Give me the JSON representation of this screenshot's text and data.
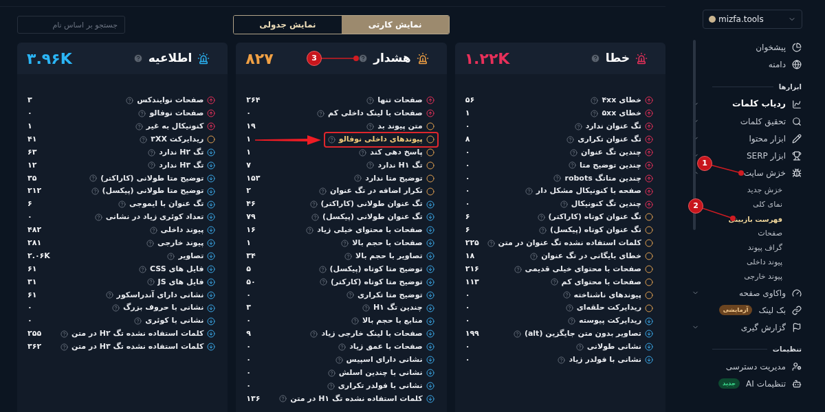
{
  "sidebar": {
    "domain": "mizfa.tools",
    "sections": [
      {
        "items": [
          {
            "label": "پیشخوان",
            "active": false
          },
          {
            "label": "دامنه",
            "active": false
          }
        ]
      },
      {
        "title": "ابزارها",
        "items": [
          {
            "label": "ردیاب کلمات",
            "active": true,
            "expanded": false
          },
          {
            "label": "تحقیق کلمات",
            "active": false,
            "expanded": false
          },
          {
            "label": "ابزار محتوا",
            "active": false,
            "expanded": false
          },
          {
            "label": "ابزار SERP",
            "active": false,
            "expanded": false
          },
          {
            "label": "خزش سایت",
            "active": false,
            "expanded": true,
            "children": [
              {
                "label": "خزش جدید",
                "selected": false
              },
              {
                "label": "نمای کلی",
                "selected": false
              },
              {
                "label": "فهرست بازبینی",
                "selected": true
              },
              {
                "label": "صفحات",
                "selected": false
              },
              {
                "label": "گراف پیوند",
                "selected": false
              },
              {
                "label": "پیوند داخلی",
                "selected": false
              },
              {
                "label": "پیوند خارجی",
                "selected": false
              }
            ]
          },
          {
            "label": "واکاوی صفحه",
            "active": false,
            "expanded": false
          },
          {
            "label": "بک لینک",
            "active": false,
            "badge": {
              "text": "آزمایشی",
              "kind": "beta"
            }
          },
          {
            "label": "گزارش گیری",
            "active": false,
            "expanded": false
          }
        ]
      },
      {
        "title": "تنظیمات",
        "items": [
          {
            "label": "مدیریت دسترسی",
            "active": false
          },
          {
            "label": "تنظیمات AI",
            "active": false,
            "badge": {
              "text": "جدید",
              "kind": "new"
            }
          }
        ]
      }
    ]
  },
  "view_tabs": [
    {
      "label": "نمایش کارتی",
      "selected": true
    },
    {
      "label": "نمایش جدولی",
      "selected": false
    }
  ],
  "search": {
    "placeholder": "جستجو بر اساس نام"
  },
  "cards": [
    {
      "title": "خطا",
      "total": "۱.۲۲K",
      "color": "#e8305a",
      "rows": [
        {
          "label": "خطای ۴xx",
          "value": "۵۶",
          "kind": "up",
          "highlighted": false
        },
        {
          "label": "خطای ۵xx",
          "value": "۱",
          "kind": "up",
          "highlighted": false
        },
        {
          "label": "تگ عنوان ندارد",
          "value": "۰",
          "kind": "up",
          "highlighted": false
        },
        {
          "label": "تگ عنوان تکراری",
          "value": "۸",
          "kind": "up",
          "highlighted": false
        },
        {
          "label": "چندین تگ عنوان",
          "value": "۰",
          "kind": "up",
          "highlighted": false
        },
        {
          "label": "چندین توضیح متا",
          "value": "۰",
          "kind": "up",
          "highlighted": false
        },
        {
          "label": "چندین متاتگ robots",
          "value": "۰",
          "kind": "up",
          "highlighted": false
        },
        {
          "label": "صفحه با کنونیکال مشکل دار",
          "value": "۰",
          "kind": "up",
          "highlighted": false
        },
        {
          "label": "چندین تگ کنونیکال",
          "value": "۰",
          "kind": "up",
          "highlighted": false
        },
        {
          "label": "تگ عنوان کوتاه (کاراکتر)",
          "value": "۶",
          "kind": "ring",
          "highlighted": false
        },
        {
          "label": "تگ عنوان کوتاه (پیکسل)",
          "value": "۶",
          "kind": "ring",
          "highlighted": false
        },
        {
          "label": "کلمات استفاده نشده تگ عنوان در متن",
          "value": "۲۲۵",
          "kind": "ring",
          "highlighted": false
        },
        {
          "label": "خطای بایگانی در تگ عنوان",
          "value": "۱۸",
          "kind": "ring",
          "highlighted": false
        },
        {
          "label": "صفحات با محتوای خیلی قدیمی",
          "value": "۲۱۶",
          "kind": "ring",
          "highlighted": false
        },
        {
          "label": "صفحات با محتوای کم",
          "value": "۱۱۳",
          "kind": "ring",
          "highlighted": false
        },
        {
          "label": "پیوندهای ناشناخته",
          "value": "۰",
          "kind": "ring",
          "highlighted": false
        },
        {
          "label": "ریدایرکت حلقه‌ای",
          "value": "۰",
          "kind": "ring",
          "highlighted": false
        },
        {
          "label": "ریدایرکت پیوسته",
          "value": "۰",
          "kind": "down",
          "highlighted": false
        },
        {
          "label": "تصاویر بدون متن جایگزین (alt)",
          "value": "۱۹۹",
          "kind": "down",
          "highlighted": false
        },
        {
          "label": "نشانی طولانی",
          "value": "۰",
          "kind": "down",
          "highlighted": false
        },
        {
          "label": "نشانی با فولدر زیاد",
          "value": "۰",
          "kind": "down",
          "highlighted": false
        }
      ]
    },
    {
      "title": "هشدار",
      "total": "۸۲۷",
      "color": "#f0a044",
      "rows": [
        {
          "label": "صفحات تنها",
          "value": "۲۶۴",
          "kind": "up",
          "highlighted": false
        },
        {
          "label": "صفحات با لینک داخلی کم",
          "value": "۰",
          "kind": "up",
          "highlighted": false
        },
        {
          "label": "متن پیوند بد",
          "value": "۱۹",
          "kind": "ring",
          "highlighted": false
        },
        {
          "label": "پیوندهای داخلی نوفالو",
          "value": "۱",
          "kind": "ring",
          "highlighted": true
        },
        {
          "label": "پاسخ دهی کند",
          "value": "۱",
          "kind": "ring",
          "highlighted": false
        },
        {
          "label": "تگ H۱ ندارد",
          "value": "۷",
          "kind": "ring",
          "highlighted": false
        },
        {
          "label": "توضیح متا ندارد",
          "value": "۱۵۳",
          "kind": "ring",
          "highlighted": false
        },
        {
          "label": "تکرار اضافه در تگ عنوان",
          "value": "۲",
          "kind": "ring",
          "highlighted": false
        },
        {
          "label": "تگ عنوان طولانی (کاراکتر)",
          "value": "۴۶",
          "kind": "down",
          "highlighted": false
        },
        {
          "label": "تگ عنوان طولانی (پیکسل)",
          "value": "۷۹",
          "kind": "down",
          "highlighted": false
        },
        {
          "label": "صفحات با محتوای خیلی زیاد",
          "value": "۱۶",
          "kind": "down",
          "highlighted": false
        },
        {
          "label": "صفحات با حجم بالا",
          "value": "۱",
          "kind": "down",
          "highlighted": false
        },
        {
          "label": "تصاویر با حجم بالا",
          "value": "۳۴",
          "kind": "down",
          "highlighted": false
        },
        {
          "label": "توضیح متا کوتاه (پیکسل)",
          "value": "۵",
          "kind": "down",
          "highlighted": false
        },
        {
          "label": "توضیح متا کوتاه (کارکتر)",
          "value": "۵۰",
          "kind": "down",
          "highlighted": false
        },
        {
          "label": "توضیح متا تکراری",
          "value": "۰",
          "kind": "down",
          "highlighted": false
        },
        {
          "label": "چندین تگ H۱",
          "value": "۳",
          "kind": "down",
          "highlighted": false
        },
        {
          "label": "منابع با حجم بالا",
          "value": "۰",
          "kind": "down",
          "highlighted": false
        },
        {
          "label": "صفحات با لینک خارجی زیاد",
          "value": "۹",
          "kind": "down",
          "highlighted": false
        },
        {
          "label": "صفحات با عمق زیاد",
          "value": "۰",
          "kind": "down",
          "highlighted": false
        },
        {
          "label": "نشانی دارای اسپیس",
          "value": "۰",
          "kind": "down",
          "highlighted": false
        },
        {
          "label": "نشانی با چندین اسلش",
          "value": "۰",
          "kind": "down",
          "highlighted": false
        },
        {
          "label": "نشانی با فولدر تکراری",
          "value": "۰",
          "kind": "down",
          "highlighted": false
        },
        {
          "label": "کلمات استفاده نشده تگ H۱ در متن",
          "value": "۱۳۶",
          "kind": "down",
          "highlighted": false
        }
      ]
    },
    {
      "title": "اطلاعیه",
      "total": "۳.۹۶K",
      "color": "#2bb5f5",
      "rows": [
        {
          "label": "صفحات نوایندکس",
          "value": "۳",
          "kind": "up",
          "highlighted": false
        },
        {
          "label": "صفحات نوفالو",
          "value": "۰",
          "kind": "up",
          "highlighted": false
        },
        {
          "label": "کنونیکال به غیر",
          "value": "۱",
          "kind": "up",
          "highlighted": false
        },
        {
          "label": "ریدایرکت ۳XX",
          "value": "۴۱",
          "kind": "ring",
          "highlighted": false
        },
        {
          "label": "تگ H۲ ندارد",
          "value": "۶۳",
          "kind": "down",
          "highlighted": false
        },
        {
          "label": "تگ H۳ ندارد",
          "value": "۱۲",
          "kind": "down",
          "highlighted": false
        },
        {
          "label": "توضیح متا طولانی (کاراکتر)",
          "value": "۳۵",
          "kind": "down",
          "highlighted": false
        },
        {
          "label": "توضیح متا طولانی (پیکسل)",
          "value": "۲۱۲",
          "kind": "down",
          "highlighted": false
        },
        {
          "label": "تگ عنوان با ایموجی",
          "value": "۶",
          "kind": "down",
          "highlighted": false
        },
        {
          "label": "تعداد کوئری زیاد در نشانی",
          "value": "۰",
          "kind": "down",
          "highlighted": false
        },
        {
          "label": "پیوند داخلی",
          "value": "۴۸۲",
          "kind": "down",
          "highlighted": false
        },
        {
          "label": "پیوند خارجی",
          "value": "۲۸۱",
          "kind": "down",
          "highlighted": false
        },
        {
          "label": "تصاویر",
          "value": "۲.۰۶K",
          "kind": "down",
          "highlighted": false
        },
        {
          "label": "فایل های CSS",
          "value": "۶۱",
          "kind": "down",
          "highlighted": false
        },
        {
          "label": "فایل های JS",
          "value": "۳۱",
          "kind": "down",
          "highlighted": false
        },
        {
          "label": "نشانی دارای آندراسکور",
          "value": "۶۱",
          "kind": "down",
          "highlighted": false
        },
        {
          "label": "نشانی با حروف بزرگ",
          "value": "۰",
          "kind": "down",
          "highlighted": false
        },
        {
          "label": "نشانی با کوئری",
          "value": "۰",
          "kind": "down",
          "highlighted": false
        },
        {
          "label": "کلمات استفاده نشده تگ H۲ در متن",
          "value": "۲۵۵",
          "kind": "down",
          "highlighted": false
        },
        {
          "label": "کلمات استفاده نشده تگ H۳ در متن",
          "value": "۳۶۲",
          "kind": "down",
          "highlighted": false
        }
      ]
    }
  ],
  "annotations": [
    {
      "label": "1"
    },
    {
      "label": "2"
    },
    {
      "label": "3"
    }
  ]
}
